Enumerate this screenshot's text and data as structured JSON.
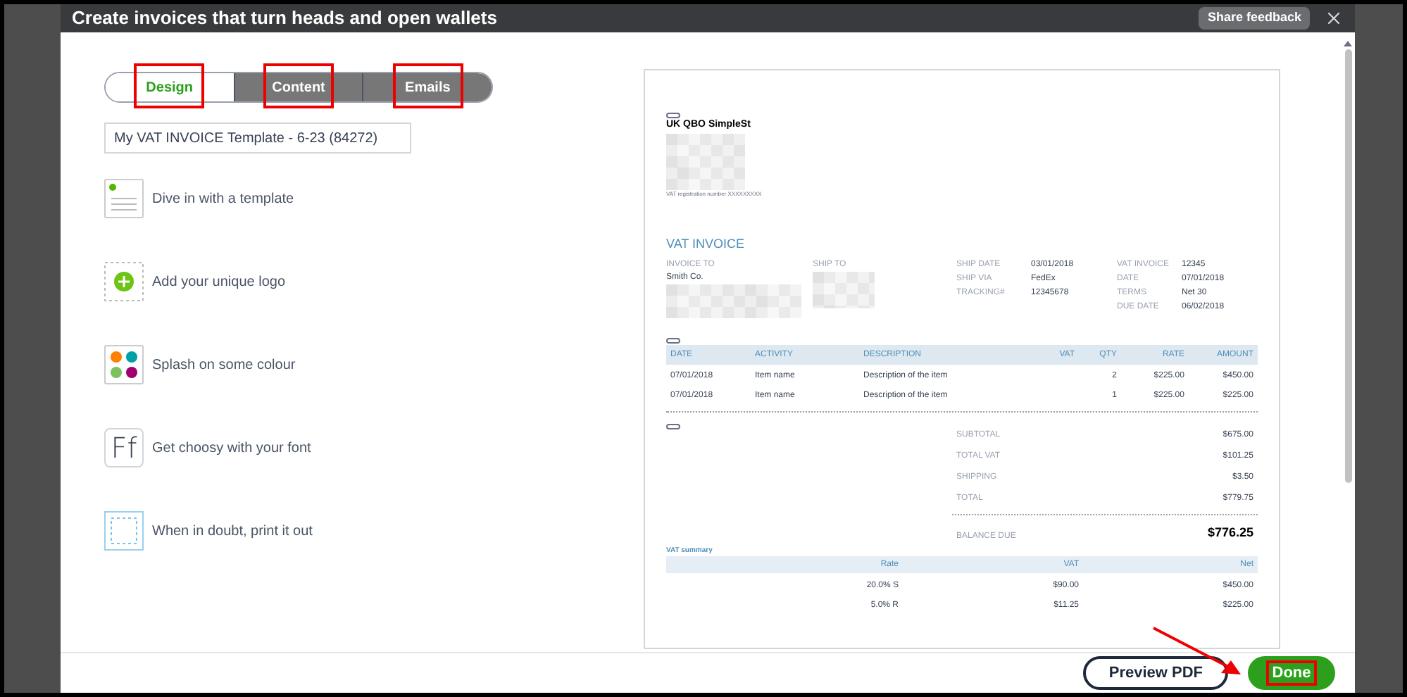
{
  "window": {
    "title": "Create invoices that turn heads and open wallets",
    "feedback_button": "Share feedback"
  },
  "tabs": [
    {
      "label": "Design",
      "selected": true,
      "annotated": true
    },
    {
      "label": "Content",
      "selected": false,
      "annotated": true
    },
    {
      "label": "Emails",
      "selected": false,
      "annotated": true
    }
  ],
  "template_name": {
    "value": "My VAT INVOICE Template - 6-23 (84272)"
  },
  "design_options": [
    {
      "kind": "template",
      "label": "Dive in with a template"
    },
    {
      "kind": "logo",
      "label": "Add your unique logo"
    },
    {
      "kind": "colour",
      "label": "Splash on some colour"
    },
    {
      "kind": "font",
      "label": "Get choosy with your font",
      "icon_text": "Ff"
    },
    {
      "kind": "print",
      "label": "When in doubt, print it out"
    }
  ],
  "invoice": {
    "company": "UK QBO SimpleSt",
    "vat_registration": "VAT registration number XXXXXXXXX",
    "title": "VAT INVOICE",
    "invoice_to": {
      "label": "INVOICE TO",
      "value": "Smith Co."
    },
    "ship_to": {
      "label": "SHIP TO"
    },
    "shipping": [
      {
        "label": "SHIP DATE",
        "value": "03/01/2018"
      },
      {
        "label": "SHIP VIA",
        "value": "FedEx"
      },
      {
        "label": "TRACKING#",
        "value": "12345678"
      }
    ],
    "details": [
      {
        "label": "VAT INVOICE",
        "value": "12345"
      },
      {
        "label": "DATE",
        "value": "07/01/2018"
      },
      {
        "label": "TERMS",
        "value": "Net 30"
      },
      {
        "label": "DUE DATE",
        "value": "06/02/2018"
      }
    ],
    "columns": [
      "DATE",
      "ACTIVITY",
      "DESCRIPTION",
      "VAT",
      "QTY",
      "RATE",
      "AMOUNT"
    ],
    "rows": [
      [
        "07/01/2018",
        "Item name",
        "Description of the item",
        "",
        "2",
        "$225.00",
        "$450.00"
      ],
      [
        "07/01/2018",
        "Item name",
        "Description of the item",
        "",
        "1",
        "$225.00",
        "$225.00"
      ]
    ],
    "totals": [
      {
        "label": "SUBTOTAL",
        "value": "$675.00"
      },
      {
        "label": "TOTAL VAT",
        "value": "$101.25"
      },
      {
        "label": "SHIPPING",
        "value": "$3.50"
      },
      {
        "label": "TOTAL",
        "value": "$779.75"
      }
    ],
    "balance_due": {
      "label": "BALANCE DUE",
      "value": "$776.25"
    },
    "vat_summary": {
      "title": "VAT summary",
      "columns": [
        "Rate",
        "VAT",
        "Net"
      ],
      "rows": [
        [
          "20.0% S",
          "$90.00",
          "$450.00"
        ],
        [
          "5.0% R",
          "$11.25",
          "$225.00"
        ]
      ]
    }
  },
  "footer": {
    "preview_button": "Preview PDF",
    "done_button": {
      "label": "Done",
      "annotated": true
    }
  }
}
